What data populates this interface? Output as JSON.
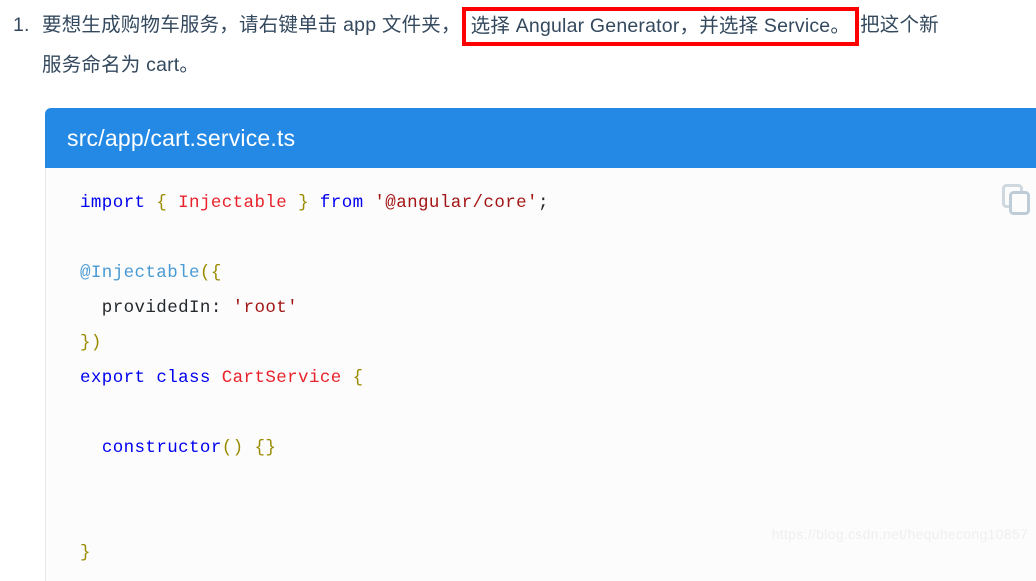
{
  "instruction": {
    "marker": "1.",
    "line1_before": "要想生成购物车服务，请右键单击 app 文件夹，",
    "highlighted": "选择 Angular Generator，并选择 Service。",
    "line1_after": "把这个新",
    "line2": "服务命名为 cart。",
    "highlight_color": "#ff0000"
  },
  "code_card": {
    "header_title": "src/app/cart.service.ts",
    "header_bg": "#2489e4",
    "copy_icon_name": "copy-icon",
    "lines": [
      {
        "id": "line-import",
        "tokens": [
          {
            "t": "import",
            "c": "kw"
          },
          {
            "t": " ",
            "c": "plain"
          },
          {
            "t": "{",
            "c": "punc"
          },
          {
            "t": " ",
            "c": "plain"
          },
          {
            "t": "Injectable",
            "c": "type"
          },
          {
            "t": " ",
            "c": "plain"
          },
          {
            "t": "}",
            "c": "punc"
          },
          {
            "t": " ",
            "c": "plain"
          },
          {
            "t": "from",
            "c": "kw"
          },
          {
            "t": " ",
            "c": "plain"
          },
          {
            "t": "'@angular/core'",
            "c": "str"
          },
          {
            "t": ";",
            "c": "plain"
          }
        ]
      },
      {
        "id": "line-blank-1",
        "tokens": []
      },
      {
        "id": "line-decorator",
        "tokens": [
          {
            "t": "@Injectable",
            "c": "deco"
          },
          {
            "t": "(",
            "c": "punc"
          },
          {
            "t": "{",
            "c": "punc"
          }
        ]
      },
      {
        "id": "line-providedin",
        "tokens": [
          {
            "t": "  providedIn",
            "c": "plain"
          },
          {
            "t": ":",
            "c": "plain"
          },
          {
            "t": " ",
            "c": "plain"
          },
          {
            "t": "'root'",
            "c": "str"
          }
        ]
      },
      {
        "id": "line-close-decorator",
        "tokens": [
          {
            "t": "}",
            "c": "punc"
          },
          {
            "t": ")",
            "c": "punc"
          }
        ]
      },
      {
        "id": "line-export-class",
        "tokens": [
          {
            "t": "export",
            "c": "kw"
          },
          {
            "t": " ",
            "c": "plain"
          },
          {
            "t": "class",
            "c": "kw"
          },
          {
            "t": " ",
            "c": "plain"
          },
          {
            "t": "CartService",
            "c": "type"
          },
          {
            "t": " ",
            "c": "plain"
          },
          {
            "t": "{",
            "c": "punc"
          }
        ]
      },
      {
        "id": "line-blank-2",
        "tokens": []
      },
      {
        "id": "line-constructor",
        "tokens": [
          {
            "t": "  ",
            "c": "plain"
          },
          {
            "t": "constructor",
            "c": "kw"
          },
          {
            "t": "(",
            "c": "punc"
          },
          {
            "t": ")",
            "c": "punc"
          },
          {
            "t": " ",
            "c": "plain"
          },
          {
            "t": "{",
            "c": "punc"
          },
          {
            "t": "}",
            "c": "punc"
          }
        ]
      },
      {
        "id": "line-blank-3",
        "tokens": []
      },
      {
        "id": "line-blank-4",
        "tokens": []
      },
      {
        "id": "line-close-class",
        "tokens": [
          {
            "t": "}",
            "c": "punc"
          }
        ]
      }
    ]
  },
  "watermark": {
    "text": "https://blog.csdn.net/hequhecong10857"
  }
}
